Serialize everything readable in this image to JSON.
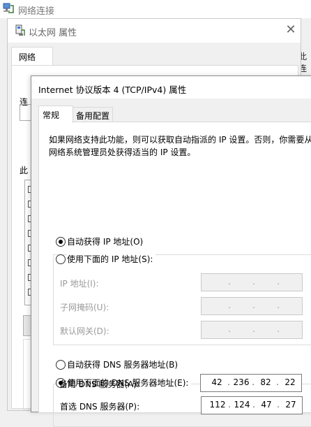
{
  "background_window": {
    "title": "网络连接",
    "partial_right_label": "此连"
  },
  "properties_dialog": {
    "title": "以太网 属性",
    "close_glyph": "✕",
    "tab_network": "网络",
    "label_connect_partial": "连",
    "label_this_partial": "此"
  },
  "ipv4_dialog": {
    "title": "Internet 协议版本 4 (TCP/IPv4) 属性",
    "tab_general": "常规",
    "tab_alternate": "备用配置",
    "description": "如果网络支持此功能，则可以获取自动指派的 IP 设置。否则，你需要从网络系统管理员处获得适当的 IP 设置。",
    "ip_auto_label": "自动获得 IP 地址(O)",
    "ip_manual_label": "使用下面的 IP 地址(S):",
    "ip_auto_selected": true,
    "ip_address_label": "IP 地址(I):",
    "subnet_mask_label": "子网掩码(U):",
    "gateway_label": "默认网关(D):",
    "dns_auto_label": "自动获得 DNS 服务器地址(B)",
    "dns_manual_label": "使用下面的 DNS 服务器地址(E):",
    "dns_manual_selected": true,
    "preferred_dns_label": "首选 DNS 服务器(P):",
    "alternate_dns_label": "备用 DNS 服务器(A):",
    "preferred_dns": {
      "o1": "112",
      "o2": "124",
      "o3": "47",
      "o4": "27"
    },
    "alternate_dns": {
      "o1": "42",
      "o2": "236",
      "o3": "82",
      "o4": "22"
    },
    "dot": "."
  }
}
